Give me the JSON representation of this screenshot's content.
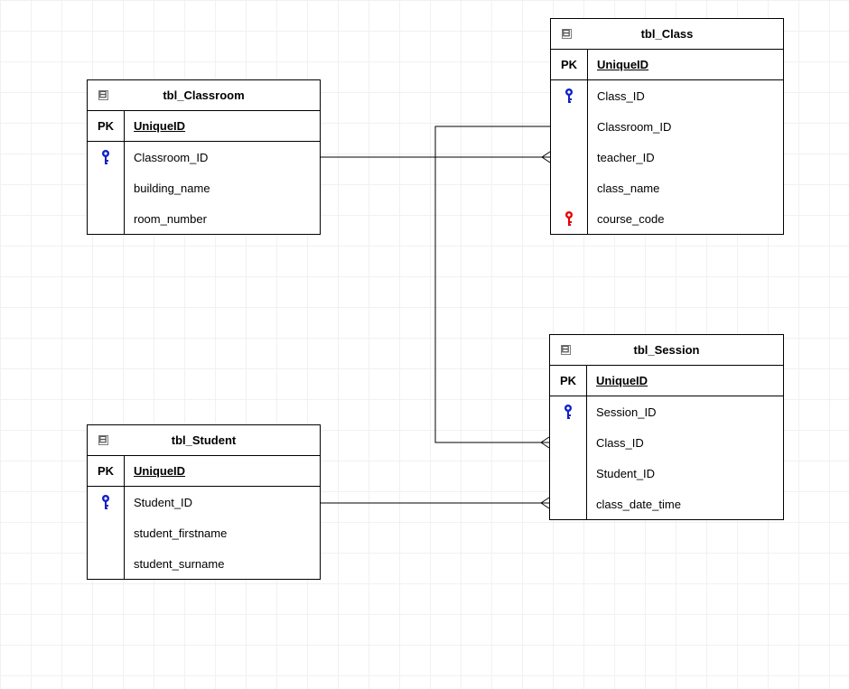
{
  "diagram_type": "entity-relationship",
  "entities": {
    "classroom": {
      "title": "tbl_Classroom",
      "pk_label": "PK",
      "pk_field": "UniqueID",
      "fields": [
        "Classroom_ID",
        "building_name",
        "room_number"
      ],
      "key_icons": [
        {
          "row": 0,
          "color": "blue"
        }
      ]
    },
    "class": {
      "title": "tbl_Class",
      "pk_label": "PK",
      "pk_field": "UniqueID",
      "fields": [
        "Class_ID",
        "Classroom_ID",
        "teacher_ID",
        "class_name",
        "course_code"
      ],
      "key_icons": [
        {
          "row": 0,
          "color": "blue"
        },
        {
          "row": 4,
          "color": "red"
        }
      ]
    },
    "student": {
      "title": "tbl_Student",
      "pk_label": "PK",
      "pk_field": "UniqueID",
      "fields": [
        "Student_ID",
        "student_firstname",
        "student_surname"
      ],
      "key_icons": [
        {
          "row": 0,
          "color": "blue"
        }
      ]
    },
    "session": {
      "title": "tbl_Session",
      "pk_label": "PK",
      "pk_field": "UniqueID",
      "fields": [
        "Session_ID",
        "Class_ID",
        "Student_ID",
        "class_date_time"
      ],
      "key_icons": [
        {
          "row": 0,
          "color": "blue"
        }
      ]
    }
  },
  "relationships": [
    {
      "from": "classroom",
      "to": "class",
      "type": "one-to-many"
    },
    {
      "from": "class",
      "to": "session",
      "type": "one-to-many"
    },
    {
      "from": "student",
      "to": "session",
      "type": "one-to-many"
    }
  ],
  "collapse_glyph": "⊟"
}
